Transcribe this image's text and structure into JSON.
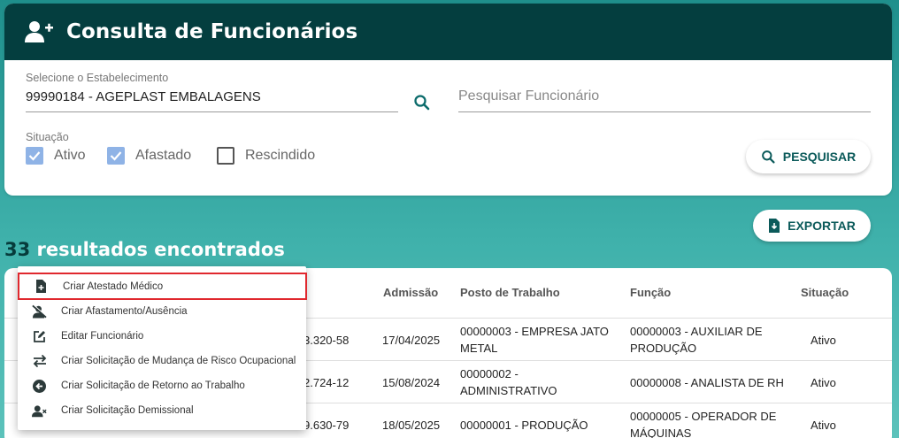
{
  "colors": {
    "header_bg": "#043e3f",
    "accent": "#0b5a5a",
    "checkbox_checked": "#8fb3e6",
    "highlight_border": "#e0282e"
  },
  "header": {
    "title": "Consulta de Funcionários",
    "icon": "user-add-icon"
  },
  "filters": {
    "establishment_label": "Selecione o Estabelecimento",
    "establishment_value": "99990184 - AGEPLAST EMBALAGENS",
    "employee_search_placeholder": "Pesquisar Funcionário",
    "situation_label": "Situação",
    "options": [
      {
        "label": "Ativo",
        "checked": true
      },
      {
        "label": "Afastado",
        "checked": true
      },
      {
        "label": "Rescindido",
        "checked": false
      }
    ],
    "search_button": "PESQUISAR"
  },
  "export_button": "EXPORTAR",
  "results": {
    "count": "33",
    "text": "resultados encontrados"
  },
  "table": {
    "headers": [
      "Admissão",
      "Posto de Trabalho",
      "Função",
      "Situação"
    ],
    "rows": [
      {
        "cpf_fragment": "3.320-58",
        "admission": "17/04/2025",
        "post_line1": "00000003 - EMPRESA JATO",
        "post_line2": "METAL",
        "function_line1": "00000003 - AUXILIAR DE",
        "function_line2": "PRODUÇÃO",
        "status": "Ativo"
      },
      {
        "cpf_fragment": "2.724-12",
        "admission": "15/08/2024",
        "post_line1": "00000002 -",
        "post_line2": "ADMINISTRATIVO",
        "function_line1": "00000008 - ANALISTA DE RH",
        "function_line2": "",
        "status": "Ativo"
      },
      {
        "cpf_fragment": "9.630-79",
        "admission": "18/05/2025",
        "post_line1": "00000001 - PRODUÇÃO",
        "post_line2": "",
        "function_line1": "00000005 - OPERADOR DE",
        "function_line2": "MÁQUINAS",
        "status": "Ativo"
      }
    ]
  },
  "context_menu": {
    "items": [
      {
        "label": "Criar Atestado Médico",
        "icon": "file-plus-icon",
        "highlighted": true
      },
      {
        "label": "Criar Afastamento/Ausência",
        "icon": "user-off-icon",
        "highlighted": false
      },
      {
        "label": "Editar Funcionário",
        "icon": "edit-icon",
        "highlighted": false
      },
      {
        "label": "Criar Solicitação de Mudança de Risco Ocupacional",
        "icon": "swap-icon",
        "highlighted": false
      },
      {
        "label": "Criar Solicitação de Retorno ao Trabalho",
        "icon": "arrow-left-circle-icon",
        "highlighted": false
      },
      {
        "label": "Criar Solicitação Demissional",
        "icon": "user-remove-icon",
        "highlighted": false
      }
    ]
  }
}
